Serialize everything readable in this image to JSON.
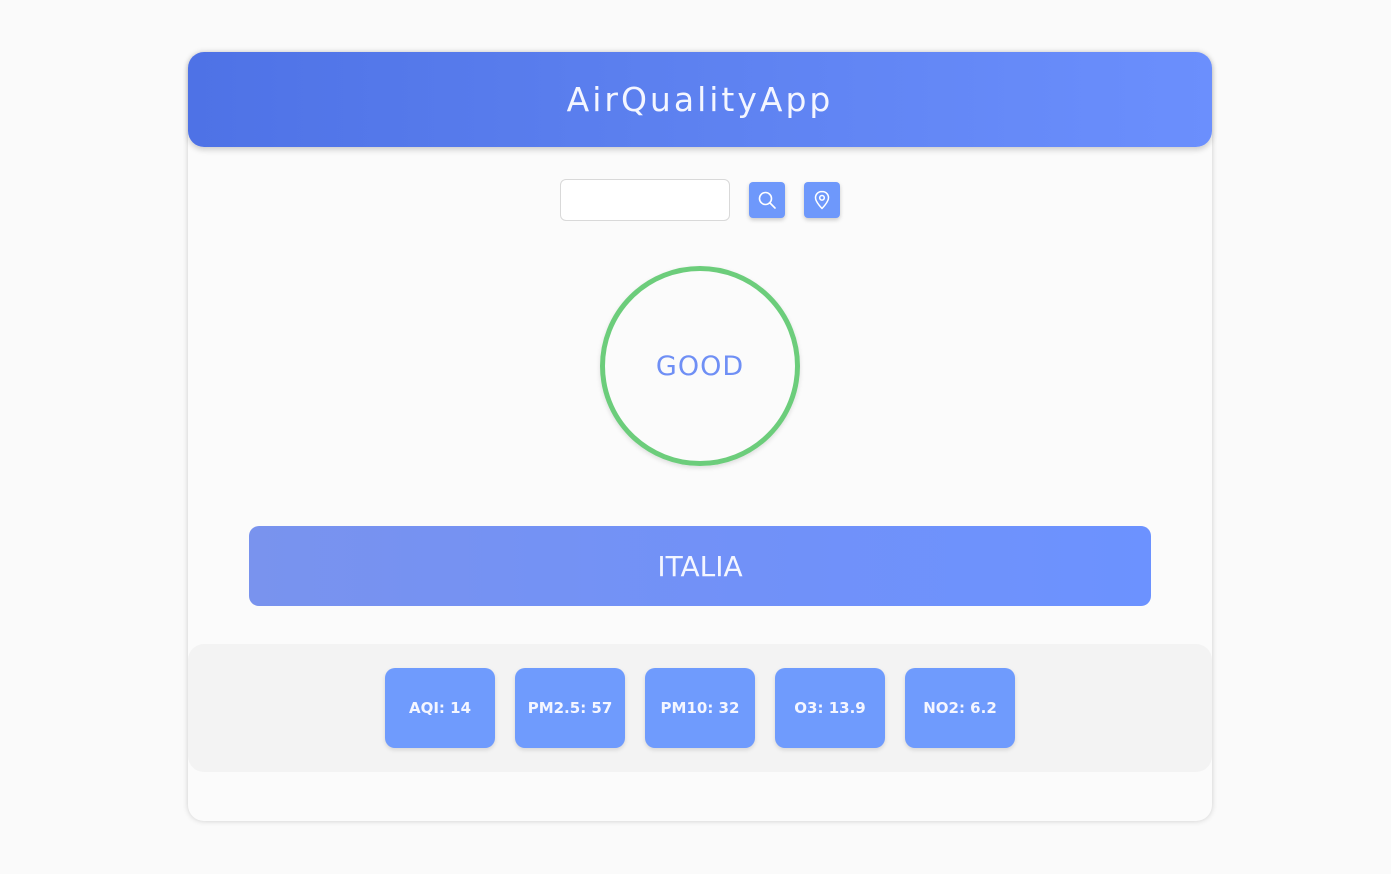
{
  "header": {
    "title": "AirQualityApp",
    "gradient": [
      "#4e72e6",
      "#6b8ffd"
    ]
  },
  "search": {
    "value": "",
    "placeholder": "",
    "search_icon": "search-icon",
    "location_icon": "map-pin-icon",
    "button_color": "#6e98fb"
  },
  "status": {
    "label": "GOOD",
    "ring_color": "#6ccd7b",
    "text_color": "#6f8ff5"
  },
  "location": {
    "name": "ITALIA"
  },
  "metrics": [
    {
      "text": "AQI: 14"
    },
    {
      "text": "PM2.5: 57"
    },
    {
      "text": "PM10: 32"
    },
    {
      "text": "O3: 13.9"
    },
    {
      "text": "NO2: 6.2"
    }
  ]
}
